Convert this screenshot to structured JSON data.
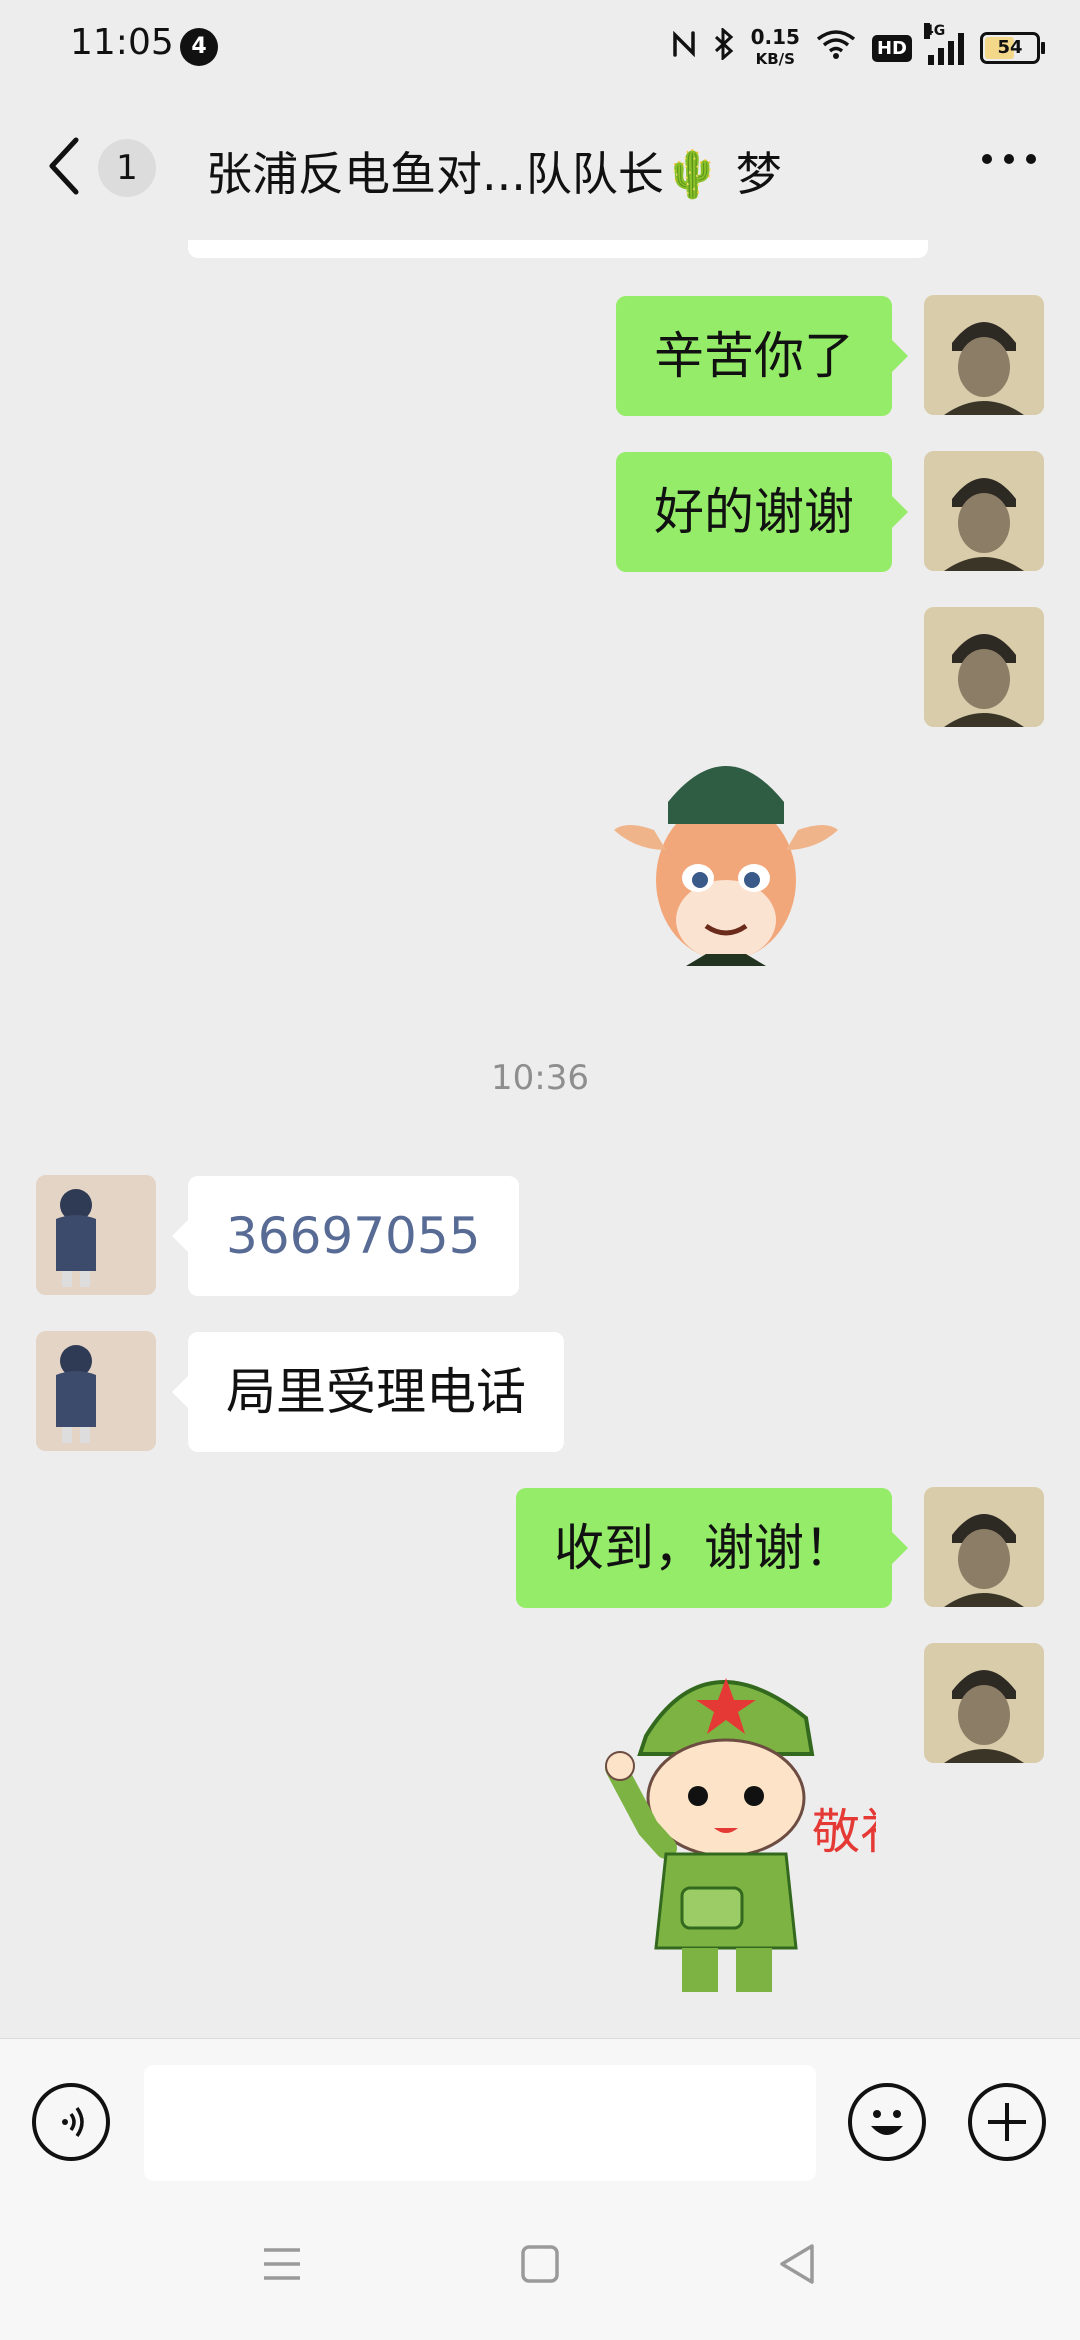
{
  "status_bar": {
    "time": "11:05",
    "notification_count": "4",
    "net_speed_value": "0.15",
    "net_speed_unit": "KB/S",
    "hd_label": "HD",
    "network_type": "4G",
    "battery_level": "54"
  },
  "header": {
    "unread_count": "1",
    "title": "张浦反电鱼对...队队长🌵 梦"
  },
  "messages": [
    {
      "sender": "me",
      "text": "辛苦你了"
    },
    {
      "sender": "me",
      "text": "好的谢谢"
    },
    {
      "sender": "me",
      "type": "sticker",
      "sticker": "deer-in-cap-sticker"
    },
    {
      "type": "timestamp",
      "text": "10:36"
    },
    {
      "sender": "other",
      "text": "36697055"
    },
    {
      "sender": "other",
      "text": "局里受理电话"
    },
    {
      "sender": "me",
      "text": "收到，谢谢！"
    },
    {
      "sender": "me",
      "type": "sticker",
      "sticker": "saluting-soldier-sticker",
      "caption": "敬礼"
    }
  ],
  "input_bar": {
    "voice_icon": "voice-icon",
    "emoji_icon": "emoji-icon",
    "plus_icon": "plus-icon",
    "input_value": ""
  },
  "colors": {
    "background": "#ededed",
    "my_bubble": "#95ec69",
    "other_bubble": "#ffffff",
    "link_number": "#576b95"
  }
}
